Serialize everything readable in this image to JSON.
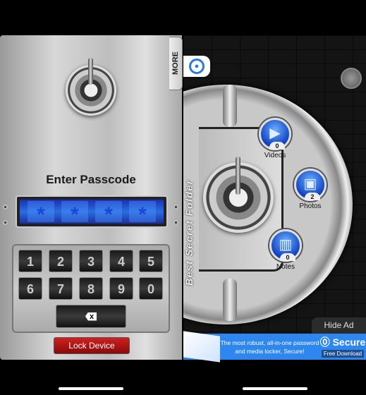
{
  "lock_screen": {
    "more_tab": "MORE",
    "title": "Enter Passcode",
    "passcode_mask": [
      "*",
      "*",
      "*",
      "*"
    ],
    "keys": [
      "1",
      "2",
      "3",
      "4",
      "5",
      "6",
      "7",
      "8",
      "9",
      "0"
    ],
    "delete_label": "x",
    "lock_button": "Lock Device"
  },
  "vault": {
    "brand_vertical": "Best Secret Folder",
    "categories": [
      {
        "label": "Videos",
        "count": "0",
        "icon": "video-camera-icon"
      },
      {
        "label": "Photos",
        "count": "2",
        "icon": "picture-icon"
      },
      {
        "label": "Notes",
        "count": "0",
        "icon": "book-icon"
      }
    ],
    "hide_ad": "Hide Ad"
  },
  "ad": {
    "text": "The most robust, all-in-one password and media locker, Secure!",
    "brand": "Secure",
    "cta": "Free Download"
  },
  "colors": {
    "accent": "#2e86ef",
    "lock_red": "#b01818",
    "display_blue": "#1a3ec8"
  }
}
